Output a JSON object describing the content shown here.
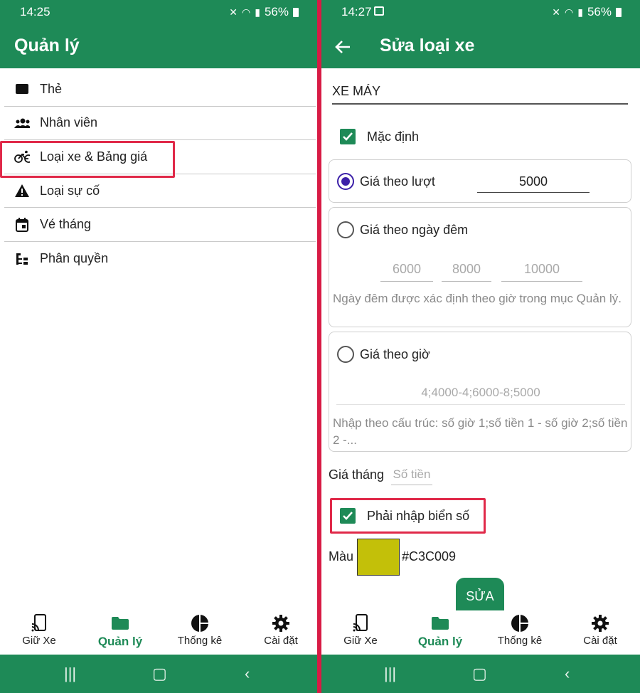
{
  "left": {
    "status": {
      "time": "14:25",
      "battery": "56%"
    },
    "title": "Quản lý",
    "menu": [
      {
        "label": "Thẻ",
        "icon": "card-icon"
      },
      {
        "label": "Nhân viên",
        "icon": "people-icon"
      },
      {
        "label": "Loại xe & Bảng giá",
        "icon": "bicycle-icon"
      },
      {
        "label": "Loại sự cố",
        "icon": "warning-icon"
      },
      {
        "label": "Vé tháng",
        "icon": "calendar-icon"
      },
      {
        "label": "Phân quyền",
        "icon": "tree-icon"
      }
    ]
  },
  "right": {
    "status": {
      "time": "14:27",
      "battery": "56%"
    },
    "title": "Sửa loại xe",
    "vehicle_name": "XE MÁY",
    "default_label": "Mặc định",
    "per_trip": {
      "label": "Giá theo lượt",
      "value": "5000"
    },
    "per_day": {
      "label": "Giá theo ngày đêm",
      "hints": [
        "6000",
        "8000",
        "10000"
      ],
      "help": "Ngày đêm được xác định theo giờ trong mục Quản lý."
    },
    "per_hour": {
      "label": "Giá theo giờ",
      "hint": "4;4000-4;6000-8;5000",
      "help": "Nhập theo cấu trúc: số giờ 1;số tiền 1 - số giờ 2;số tiền 2 -..."
    },
    "monthly": {
      "label": "Giá tháng",
      "placeholder": "Số tiền"
    },
    "plate_required_label": "Phải nhập biển số",
    "color": {
      "label": "Màu",
      "hex": "#C3C009"
    },
    "submit_label": "SỬA"
  },
  "nav": [
    {
      "label": "Giữ Xe",
      "icon": "phone-cast-icon"
    },
    {
      "label": "Quản lý",
      "icon": "folder-icon"
    },
    {
      "label": "Thống kê",
      "icon": "pie-chart-icon"
    },
    {
      "label": "Cài đặt",
      "icon": "gear-icon"
    }
  ],
  "colors": {
    "primary": "#1e8a57",
    "highlight": "#e02949",
    "radio": "#3b1fa8"
  }
}
